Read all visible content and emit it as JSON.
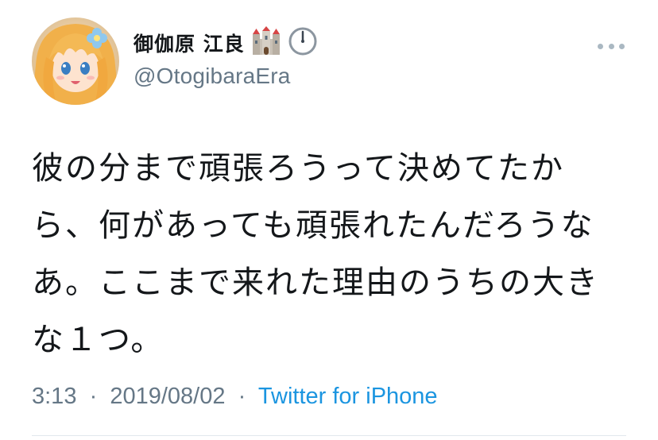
{
  "tweet": {
    "user": {
      "display_name": "御伽原 江良",
      "emoji": [
        "castle-emoji",
        "clock-emoji"
      ],
      "handle": "@OtogibaraEra"
    },
    "text_lines": [
      "彼の分まで頑張ろうって決めてたか",
      "ら、何があっても頑張れたんだろうな",
      "あ。ここまで来れた理由のうちの大き",
      "な１つ。"
    ],
    "meta": {
      "time": "3:13",
      "separator": "·",
      "date": "2019/08/02",
      "source": "Twitter for iPhone"
    },
    "colors": {
      "link": "#1b95e0",
      "muted": "#657786",
      "text": "#14171a"
    }
  }
}
